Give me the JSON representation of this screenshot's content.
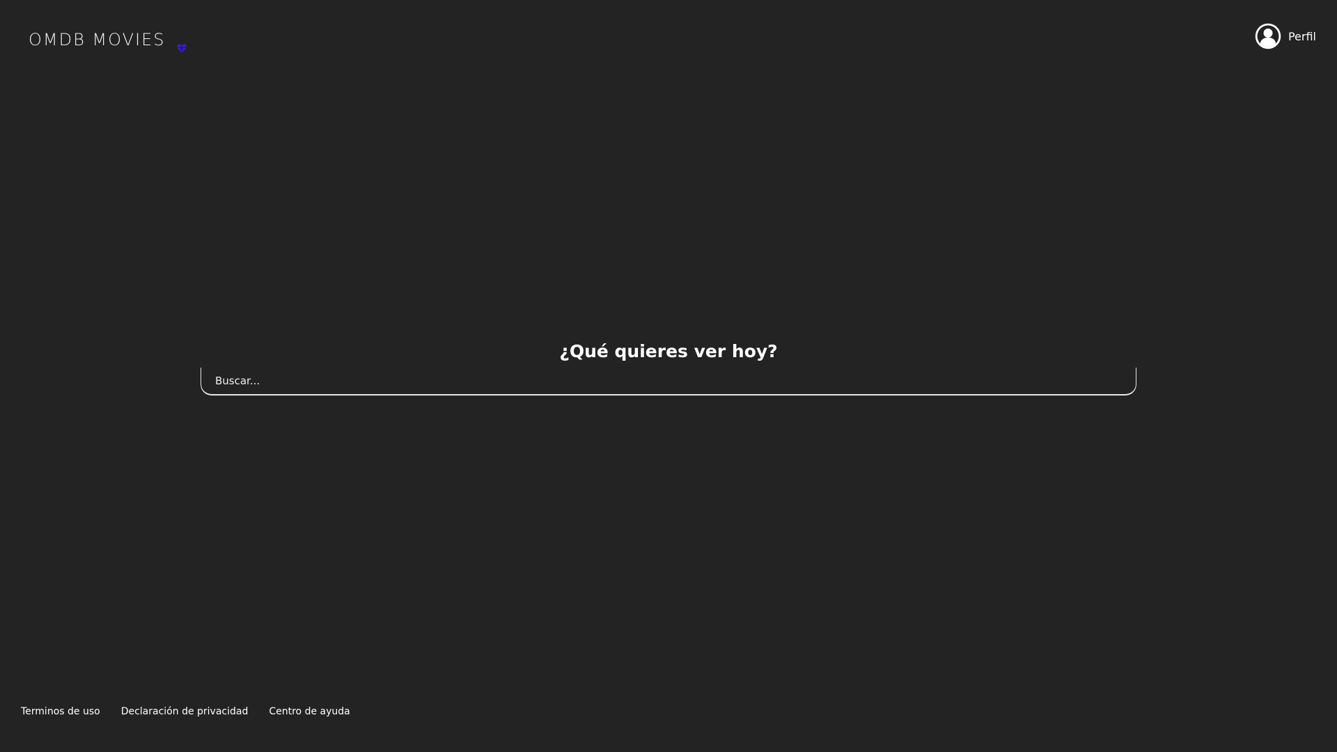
{
  "header": {
    "brand_name": "OMDB MOVIES",
    "brand_icon": "heart-gem-icon",
    "brand_icon_color": "#3d21c9",
    "profile_label": "Perfil",
    "profile_icon": "user-avatar-icon"
  },
  "main": {
    "title": "¿Qué quieres ver hoy?",
    "search_placeholder": "Buscar...",
    "search_value": ""
  },
  "footer": {
    "links": [
      {
        "label": "Terminos de uso"
      },
      {
        "label": "Declaración de privacidad"
      },
      {
        "label": "Centro de ayuda"
      }
    ]
  },
  "colors": {
    "background": "#232323",
    "text": "#ffffff",
    "accent": "#3d21c9"
  }
}
